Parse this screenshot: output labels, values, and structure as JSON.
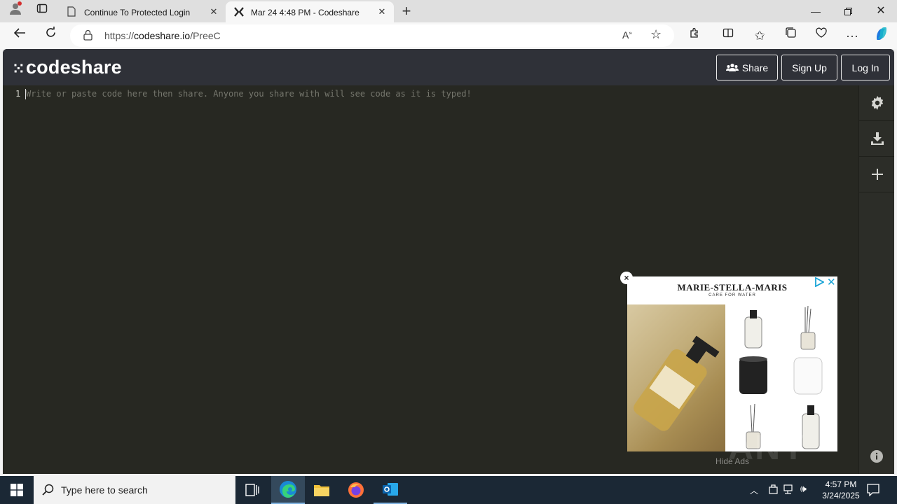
{
  "browser": {
    "tabs": [
      {
        "title": "Continue To Protected Login",
        "active": false
      },
      {
        "title": "Mar 24 4:48 PM - Codeshare",
        "active": true
      }
    ],
    "url_prefix": "https://",
    "url_host": "codeshare.io",
    "url_path": "/PreeC"
  },
  "codeshare": {
    "logo_text": "codeshare",
    "share_label": "Share",
    "signup_label": "Sign Up",
    "login_label": "Log In",
    "line_number": "1",
    "placeholder": "Write or paste code here then share. Anyone you share with will see code as it is typed!"
  },
  "ad": {
    "brand": "MARIE-STELLA-MARIS",
    "tagline": "CARE FOR WATER",
    "close_label": "×",
    "hide_ads_label": "Hide Ads"
  },
  "watermark": "ANY RUN",
  "taskbar": {
    "search_placeholder": "Type here to search",
    "time": "4:57 PM",
    "date": "3/24/2025"
  },
  "colors": {
    "editor_bg": "#272822",
    "header_bg": "#2f3138",
    "taskbar_bg": "#1b2835"
  }
}
